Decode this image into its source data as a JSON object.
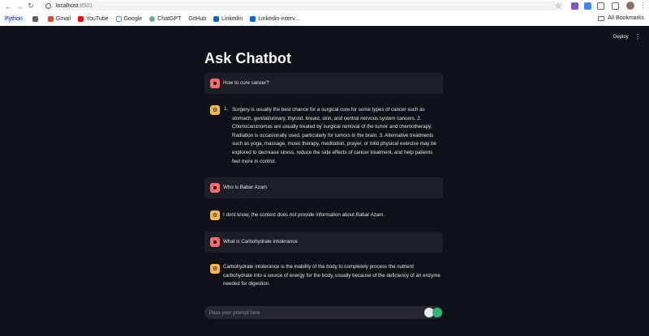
{
  "browser": {
    "url_host": "localhost",
    "url_port": ":8501",
    "bookmarks": [
      "Python",
      "Gmail",
      "YouTube",
      "Google",
      "ChatGPT",
      "GitHub",
      "Linkedin",
      "Linkedin-interv..."
    ],
    "all_bookmarks": "All Bookmarks"
  },
  "app": {
    "deploy_label": "Deploy",
    "title": "Ask Chatbot"
  },
  "messages": [
    {
      "role": "user",
      "text": "How to cure cancer?"
    },
    {
      "role": "assistant",
      "list_number": "1.",
      "lines": [
        "Surgery is usually the best chance for a surgical cure for some types of cancer such as",
        "stomach, genital/urinary, thyroid, breast, skin, and central nervous system cancers. 2.",
        "Choriocarcinomas are usually treated by surgical removal of the tumor and chemotherapy.",
        "Radiation is occasionally used, particularly for tumors in the brain. 3. Alternative treatments",
        "such as yoga, massage, music therapy, meditation, prayer, or mild physical exercise may be",
        "explored to decrease stress, reduce the side effects of cancer treatment, and help patients",
        "feel more in control."
      ]
    },
    {
      "role": "user",
      "text": "Who is Babar Azam"
    },
    {
      "role": "assistant",
      "lines": [
        "I dont know, the context does not provide information about Babar Azam."
      ]
    },
    {
      "role": "user",
      "text": "What is Carbohydrate intolerance"
    },
    {
      "role": "assistant",
      "lines": [
        "Carbohydrate intolerance is the inability of the body to completely process the nutrient",
        "carbohydrate into a source of energy for the body, usually because of the deficiency of an enzyme",
        "needed for digestion."
      ]
    }
  ],
  "input": {
    "placeholder": "Pass your prompt here"
  }
}
